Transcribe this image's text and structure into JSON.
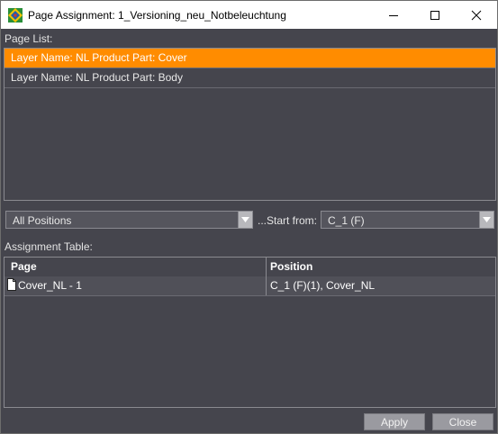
{
  "window": {
    "title": "Page Assignment: 1_Versioning_neu_Notbeleuchtung",
    "icon": "app-logo-icon",
    "controls": {
      "minimize": "minimize-icon",
      "maximize": "maximize-icon",
      "close": "close-icon"
    }
  },
  "page_list": {
    "label": "Page List:",
    "items": [
      {
        "label": "Layer Name: NL Product Part: Cover",
        "selected": true
      },
      {
        "label": "Layer Name: NL Product Part: Body",
        "selected": false
      }
    ]
  },
  "filters": {
    "positions_select": {
      "value": "All Positions"
    },
    "start_from_label": "...Start from:",
    "start_from_select": {
      "value": "C_1 (F)"
    }
  },
  "assignment_table": {
    "label": "Assignment Table:",
    "columns": [
      "Page",
      "Position"
    ],
    "rows": [
      {
        "page": "Cover_NL - 1",
        "position": "C_1 (F)(1), Cover_NL",
        "icon": "document-icon"
      }
    ]
  },
  "buttons": {
    "apply": "Apply",
    "close": "Close"
  },
  "colors": {
    "accent": "#ff8c00",
    "panel": "#45454d"
  }
}
